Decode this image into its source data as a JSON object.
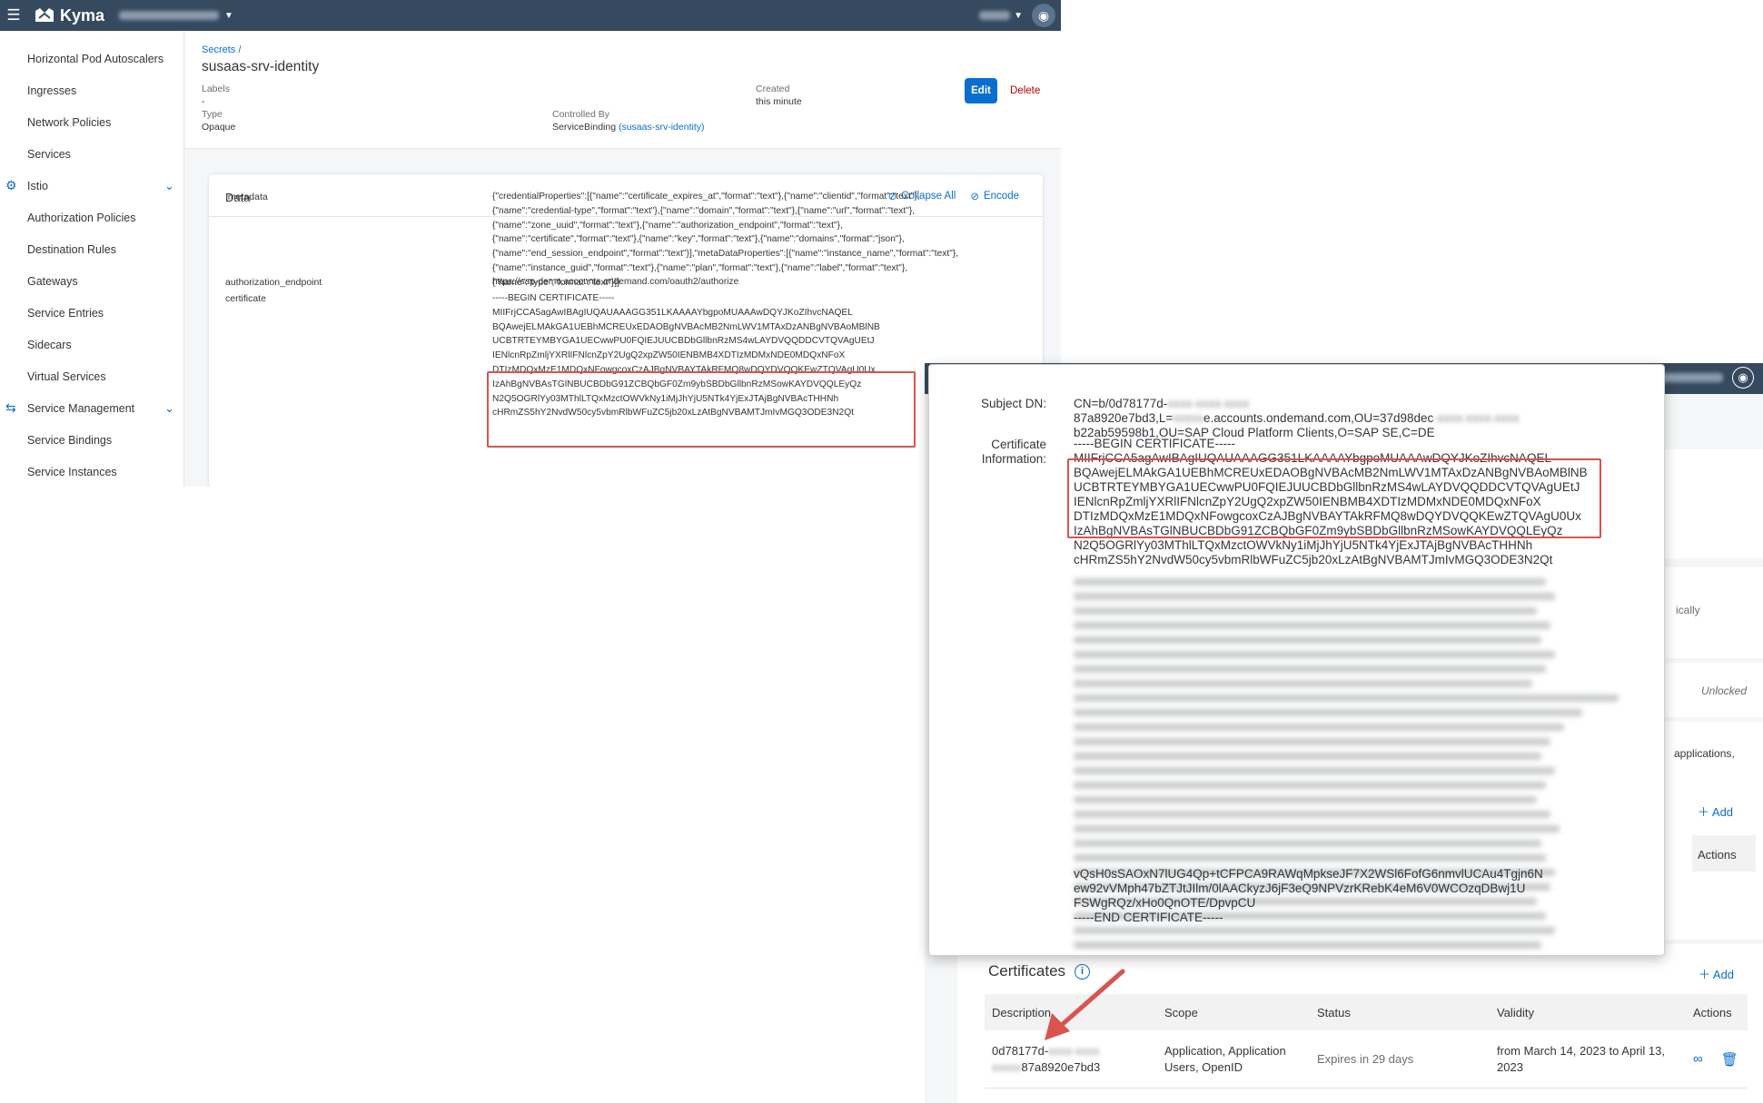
{
  "kyma": {
    "app_name": "Kyma",
    "nav": {
      "items_top": [
        "Horizontal Pod Autoscalers",
        "Ingresses",
        "Network Policies",
        "Services"
      ],
      "group_istio": "Istio",
      "istio_items": [
        "Authorization Policies",
        "Destination Rules",
        "Gateways",
        "Service Entries",
        "Sidecars",
        "Virtual Services"
      ],
      "group_sm": "Service Management",
      "sm_items": [
        "Service Bindings",
        "Service Instances"
      ]
    },
    "header": {
      "breadcrumb": "Secrets /",
      "title": "susaas-srv-identity",
      "labels_label": "Labels",
      "labels_value": "-",
      "created_label": "Created",
      "created_value": "this minute",
      "type_label": "Type",
      "type_value": "Opaque",
      "controlled_label": "Controlled By",
      "controlled_prefix": "ServiceBinding",
      "controlled_link": "(susaas-srv-identity)",
      "edit": "Edit",
      "delete": "Delete"
    },
    "data_card": {
      "title": "Data",
      "collapse_all": "Collapse All",
      "encode": "Encode",
      "metadata_key": ".metadata",
      "metadata_value": [
        "{\"credentialProperties\":[{\"name\":\"certificate_expires_at\",\"format\":\"text\"},{\"name\":\"clientid\",\"format\":\"text\"},",
        "{\"name\":\"credential-type\",\"format\":\"text\"},{\"name\":\"domain\",\"format\":\"text\"},{\"name\":\"url\",\"format\":\"text\"},",
        "{\"name\":\"zone_uuid\",\"format\":\"text\"},{\"name\":\"authorization_endpoint\",\"format\":\"text\"},",
        "{\"name\":\"certificate\",\"format\":\"text\"},{\"name\":\"key\",\"format\":\"text\"},{\"name\":\"domains\",\"format\":\"json\"},",
        "{\"name\":\"end_session_endpoint\",\"format\":\"text\"}],\"metaDataProperties\":[{\"name\":\"instance_name\",\"format\":\"text\"},",
        "{\"name\":\"instance_guid\",\"format\":\"text\"},{\"name\":\"plan\",\"format\":\"text\"},{\"name\":\"label\",\"format\":\"text\"},",
        "{\"name\":\"type\",\"format\":\"text\"}]}"
      ],
      "auth_key": "authorization_endpoint",
      "auth_value": "https://sap-demo.accounts.ondemand.com/oauth2/authorize",
      "cert_key": "certificate",
      "cert_lines": [
        "-----BEGIN CERTIFICATE-----",
        "MIIFrjCCA5agAwIBAgIUQAUAAAGG351LKAAAAYbgpoMUAAAwDQYJKoZIhvcNAQEL",
        "BQAwejELMAkGA1UEBhMCREUxEDAOBgNVBAcMB2NmLWV1MTAxDzANBgNVBAoMBlNB",
        "UCBTRTEYMBYGA1UECwwPU0FQIEJUUCBDbGllbnRzMS4wLAYDVQQDDCVTQVAgUEtJ",
        "IENlcnRpZmljYXRlIFNlcnZpY2UgQ2xpZW50IENBMB4XDTIzMDMxNDE0MDQxNFoX",
        "DTIzMDQxMzE1MDQxNFowgcoxCzAJBgNVBAYTAkRFMQ8wDQYDVQQKEwZTQVAgU0Ux",
        "IzAhBgNVBAsTGlNBUCBDbG91ZCBQbGF0Zm9ybSBDbGllbnRzMSowKAYDVQQLEyQz",
        "N2Q5OGRlYy03MThlLTQxMzctOWVkNy1iMjJhYjU5NTk4YjExJTAjBgNVBAcTHHNh",
        "cHRmZS5hY2NvdW50cy5vbmRlbWFuZC5jb20xLzAtBgNVBAMTJmIvMGQ3ODE3N2Qt"
      ]
    }
  },
  "btp": {
    "right_partial": {
      "ically": "ically",
      "unlocked": "Unlocked",
      "applications": "applications,",
      "add": "Add",
      "actions": "Actions"
    },
    "certificates": {
      "title": "Certificates",
      "add": "Add",
      "columns": [
        "Description",
        "Scope",
        "Status",
        "Validity",
        "Actions"
      ],
      "row": {
        "desc_line1": "0d78177d-",
        "desc_line2": "87a8920e7bd3",
        "scope": "Application, Application Users, OpenID",
        "status": "Expires in 29 days",
        "validity": "from March 14, 2023 to April 13, 2023"
      }
    }
  },
  "dialog": {
    "subject_label": "Subject DN:",
    "subject_lines": [
      "CN=b/0d78177d-",
      "87a8920e7bd3,L=",
      "e.accounts.ondemand.com,OU=37d98dec",
      "b22ab59598b1,OU=SAP Cloud Platform Clients,O=SAP SE,C=DE"
    ],
    "cert_label_1": "Certificate",
    "cert_label_2": "Information:",
    "cert_begin": "-----BEGIN CERTIFICATE-----",
    "cert_lines": [
      "MIIFrjCCA5agAwIBAgIUQAUAAAGG351LKAAAAYbgpoMUAAAwDQYJKoZIhvcNAQEL",
      "BQAwejELMAkGA1UEBhMCREUxEDAOBgNVBAcMB2NmLWV1MTAxDzANBgNVBAoMBlNB",
      "UCBTRTEYMBYGA1UECwwPU0FQIEJUUCBDbGllbnRzMS4wLAYDVQQDDCVTQVAgUEtJ",
      "IENlcnRpZmljYXRlIFNlcnZpY2UgQ2xpZW50IENBMB4XDTIzMDMxNDE0MDQxNFoX",
      "DTIzMDQxMzE1MDQxNFowgcoxCzAJBgNVBAYTAkRFMQ8wDQYDVQQKEwZTQVAgU0Ux",
      "IzAhBgNVBAsTGlNBUCBDbG91ZCBQbGF0Zm9ybSBDbGllbnRzMSowKAYDVQQLEyQz",
      "N2Q5OGRlYy03MThlLTQxMzctOWVkNy1iMjJhYjU5NTk4YjExJTAjBgNVBAcTHHNh",
      "cHRmZS5hY2NvdW50cy5vbmRlbWFuZC5jb20xLzAtBgNVBAMTJmIvMGQ3ODE3N2Qt"
    ],
    "cert_tail": [
      "vQsH0sSAOxN7lUG4Qp+tCFPCA9RAWqMpkseJF7X2WSl6FofG6nmvlUCAu4Tgjn6N",
      "ew92vVMph47bZTJtJIlm/0lAACkyzJ6jF3eQ9NPVzrKRebK4eM6V0WCOzqDBwj1U",
      "FSWgRQz/xHo0QnOTE/DpvpCU",
      "-----END CERTIFICATE-----"
    ]
  },
  "colors": {
    "shell": "#354a5f",
    "accent": "#0a6ed1",
    "highlight": "#d9534f",
    "delete": "#bb0000"
  }
}
